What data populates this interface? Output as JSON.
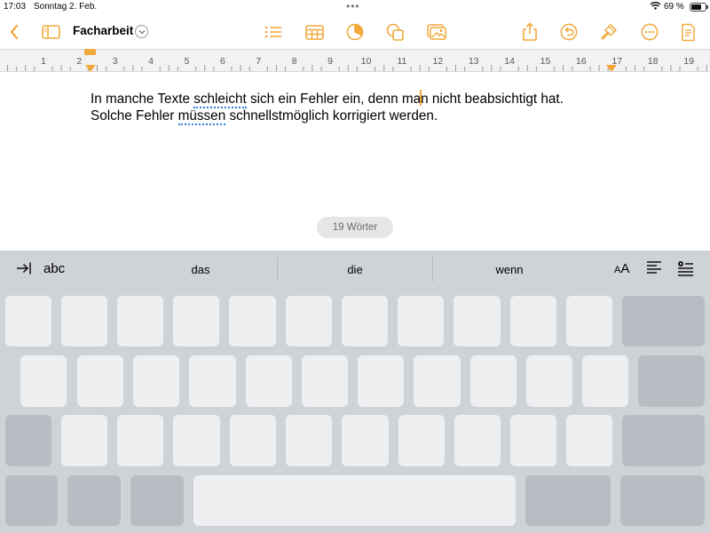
{
  "status_bar": {
    "time": "17:03",
    "date": "Sonntag 2. Feb.",
    "battery_percent": "69 %",
    "battery_level": 0.69
  },
  "toolbar": {
    "document_title": "Facharbeit",
    "accent_color": "#f2a93b",
    "icons": [
      "back-chevron",
      "sidebar",
      "list",
      "table",
      "chart",
      "shapes",
      "media",
      "share",
      "undo",
      "format-brush",
      "more",
      "document-setup"
    ]
  },
  "ruler": {
    "labels": [
      "1",
      "2",
      "3",
      "4",
      "5",
      "6",
      "7",
      "8",
      "9",
      "10",
      "11",
      "12",
      "13",
      "14",
      "15",
      "16",
      "17",
      "18",
      "19"
    ]
  },
  "document": {
    "line1": {
      "before": "In manche Texte ",
      "spell1": "schleicht",
      "middle": " sich ein Fehler ein, denn ma",
      "after": "n nicht beabsichtigt hat."
    },
    "line2": {
      "before": "Solche Fehler ",
      "spell2": "müssen",
      "after": " schnellstmöglich korrigiert werden."
    }
  },
  "word_count": "19 Wörter",
  "keyboard": {
    "abc_label": "abc",
    "suggestions": [
      "das",
      "die",
      "wenn"
    ],
    "aa_small": "A",
    "aa_large": "A"
  }
}
